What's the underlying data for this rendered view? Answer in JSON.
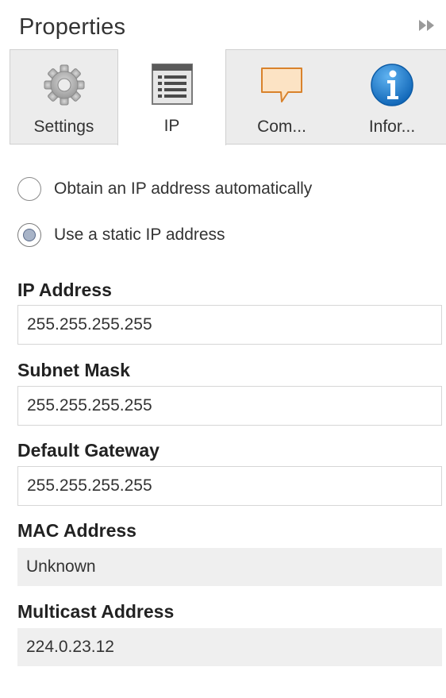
{
  "panel": {
    "title": "Properties",
    "collapse_icon": "double-chevron-right-icon"
  },
  "tabs": [
    {
      "label": "Settings",
      "icon": "gear-icon",
      "active": false
    },
    {
      "label": "IP",
      "icon": "document-list-icon",
      "active": true
    },
    {
      "label": "Com...",
      "icon": "speech-bubble-icon",
      "active": false
    },
    {
      "label": "Infor...",
      "icon": "info-icon",
      "active": false
    }
  ],
  "ip_mode": {
    "options": [
      {
        "label": "Obtain an IP address automatically",
        "checked": false
      },
      {
        "label": "Use a static IP address",
        "checked": true
      }
    ]
  },
  "fields": {
    "ip_address": {
      "label": "IP Address",
      "value": "255.255.255.255"
    },
    "subnet_mask": {
      "label": "Subnet Mask",
      "value": "255.255.255.255"
    },
    "default_gateway": {
      "label": "Default Gateway",
      "value": "255.255.255.255"
    },
    "mac_address": {
      "label": "MAC Address",
      "value": "Unknown"
    },
    "multicast_address": {
      "label": "Multicast Address",
      "value": "224.0.23.12"
    }
  },
  "colors": {
    "tab_background": "#ececec",
    "active_tab": "#ffffff",
    "readonly_field": "#efefef",
    "info_blue": "#1a7fd4",
    "bubble_fill": "#fce3c4",
    "bubble_stroke": "#d9822b"
  }
}
